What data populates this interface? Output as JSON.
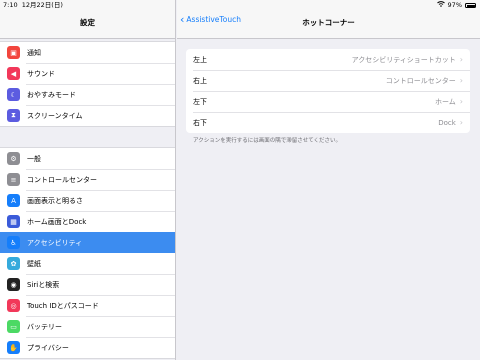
{
  "status_bar": {
    "time": "7:10",
    "date": "12月22日(日)",
    "battery": "97%",
    "wifi_icon": "wifi-icon"
  },
  "sidebar": {
    "title": "設定",
    "group1": [
      {
        "label": "通知",
        "icon": "bell-icon",
        "color": "#f2453d"
      },
      {
        "label": "サウンド",
        "icon": "speaker-icon",
        "color": "#f2385a"
      },
      {
        "label": "おやすみモード",
        "icon": "moon-icon",
        "color": "#5c5ce0"
      },
      {
        "label": "スクリーンタイム",
        "icon": "hourglass-icon",
        "color": "#5c5ce0"
      }
    ],
    "group2": [
      {
        "label": "一般",
        "icon": "gear-icon",
        "color": "#8e8e93"
      },
      {
        "label": "コントロールセンター",
        "icon": "toggles-icon",
        "color": "#8e8e93"
      },
      {
        "label": "画面表示と明るさ",
        "icon": "text-size-icon",
        "color": "#157efb"
      },
      {
        "label": "ホーム画面とDock",
        "icon": "grid-icon",
        "color": "#3b5bd9"
      },
      {
        "label": "アクセシビリティ",
        "icon": "accessibility-icon",
        "color": "#157efb",
        "selected": true
      },
      {
        "label": "壁紙",
        "icon": "flower-icon",
        "color": "#35aadc"
      },
      {
        "label": "Siriと検索",
        "icon": "siri-icon",
        "color": "#222222"
      },
      {
        "label": "Touch IDとパスコード",
        "icon": "fingerprint-icon",
        "color": "#f2385a"
      },
      {
        "label": "バッテリー",
        "icon": "battery-icon",
        "color": "#4cd964"
      },
      {
        "label": "プライバシー",
        "icon": "hand-icon",
        "color": "#157efb"
      }
    ]
  },
  "main": {
    "back_label": "AssistiveTouch",
    "title": "ホットコーナー",
    "rows": [
      {
        "key": "左上",
        "value": "アクセシビリティショートカット"
      },
      {
        "key": "右上",
        "value": "コントロールセンター"
      },
      {
        "key": "左下",
        "value": "ホーム"
      },
      {
        "key": "右下",
        "value": "Dock"
      }
    ],
    "note": "アクションを実行するには画面の隅で滞留させてください。"
  },
  "colors": {
    "accent": "#157efb",
    "selected_bg": "#3c8cf0"
  }
}
